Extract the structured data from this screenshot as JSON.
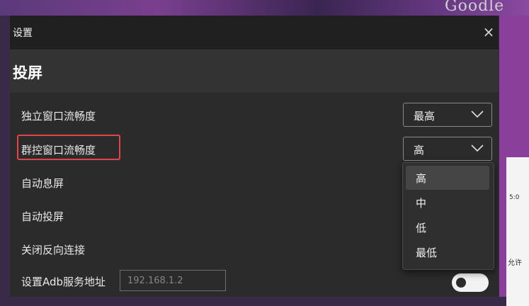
{
  "background": {
    "brand_text": "Goodle",
    "right_text_1": "5:0",
    "right_text_2": "允许"
  },
  "window": {
    "title": "设置",
    "close_icon": "×"
  },
  "section": {
    "title": "投屏"
  },
  "settings": {
    "independent_label": "独立窗口流畅度",
    "independent_value": "最高",
    "group_label": "群控窗口流畅度",
    "group_value": "高",
    "auto_screen_off_label": "自动息屏",
    "auto_cast_label": "自动投屏",
    "disable_reverse_label": "关闭反向连接",
    "adb_address_label": "设置Adb服务地址",
    "adb_address_placeholder": "192.168.1.2"
  },
  "dropdown": {
    "options": [
      "高",
      "中",
      "低",
      "最低"
    ],
    "selected": "高"
  },
  "colors": {
    "highlight_border": "#e0454a",
    "window_bg": "#2b2b2b"
  }
}
